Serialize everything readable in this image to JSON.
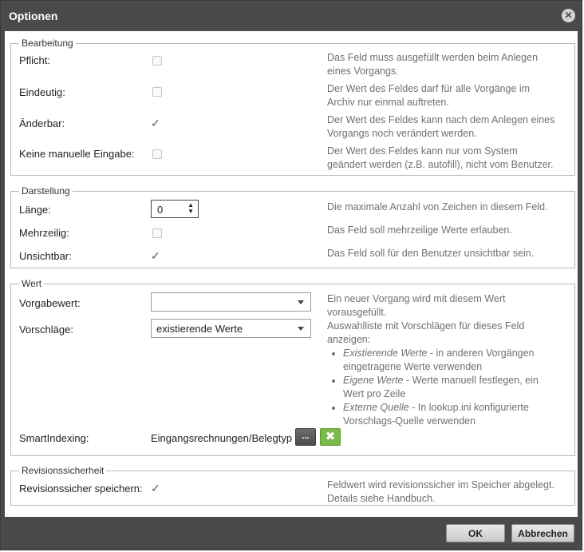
{
  "dialog": {
    "title": "Optionen",
    "close_glyph": "✕"
  },
  "sections": {
    "bearbeitung": {
      "legend": "Bearbeitung",
      "rows": [
        {
          "label": "Pflicht:",
          "checked": false,
          "description": [
            "Das Feld muss ausgefüllt werden beim Anlegen",
            "eines Vorgangs."
          ]
        },
        {
          "label": "Eindeutig:",
          "checked": false,
          "description": [
            "Der Wert des Feldes darf für alle Vorgänge im",
            "Archiv nur einmal auftreten."
          ]
        },
        {
          "label": "Änderbar:",
          "checked": true,
          "description": [
            "Der Wert des Feldes kann nach dem Anlegen eines",
            "Vorgangs noch verändert werden."
          ]
        },
        {
          "label": "Keine manuelle Eingabe:",
          "checked": false,
          "description": [
            "Der Wert des Feldes kann nur vom System",
            "geändert werden (z.B. autofill), nicht vom Benutzer."
          ]
        }
      ]
    },
    "darstellung": {
      "legend": "Darstellung",
      "laenge": {
        "label": "Länge:",
        "value": "0",
        "description": "Die maximale Anzahl von Zeichen in diesem Feld."
      },
      "mehrzeilig": {
        "label": "Mehrzeilig:",
        "checked": false,
        "description": "Das Feld soll mehrzeilige Werte erlauben."
      },
      "unsichtbar": {
        "label": "Unsichtbar:",
        "checked": true,
        "description": "Das Feld soll für den Benutzer unsichtbar sein."
      }
    },
    "wert": {
      "legend": "Wert",
      "vorgabewert": {
        "label": "Vorgabewert:",
        "value": "",
        "description": [
          "Ein neuer Vorgang wird mit diesem Wert",
          "vorausgefüllt."
        ]
      },
      "vorschlaege": {
        "label": "Vorschläge:",
        "value": "existierende Werte",
        "description": [
          "Auswahlliste mit Vorschlägen für dieses Feld",
          "anzeigen:"
        ],
        "options": [
          {
            "term": "Existierende Werte",
            "line1": " - in anderen Vorgängen",
            "line2": "eingetragene Werte verwenden"
          },
          {
            "term": "Eigene Werte",
            "line1": " - Werte manuell festlegen, ein",
            "line2": "Wert pro Zeile"
          },
          {
            "term": "Externe Quelle",
            "line1": " - In lookup.ini konfigurierte",
            "line2": "Vorschlags-Quelle verwenden"
          }
        ]
      },
      "smartindexing": {
        "label": "SmartIndexing:",
        "value": "Eingangsrechnungen/Belegtyp",
        "browse_label": "...",
        "clear_glyph": "✖"
      }
    },
    "revision": {
      "legend": "Revisionssicherheit",
      "row": {
        "label": "Revisionssicher speichern:",
        "checked": true,
        "description": [
          "Feldwert wird revisionssicher im Speicher abgelegt.",
          "Details siehe Handbuch."
        ]
      }
    }
  },
  "footer": {
    "ok_label": "OK",
    "cancel_label": "Abbrechen"
  },
  "colors": {
    "titlebar": "#4a4a4a",
    "smart_clear_button": "#7db84a"
  },
  "glyphs": {
    "check": "✓",
    "spin_up": "▲",
    "spin_down": "▼"
  }
}
